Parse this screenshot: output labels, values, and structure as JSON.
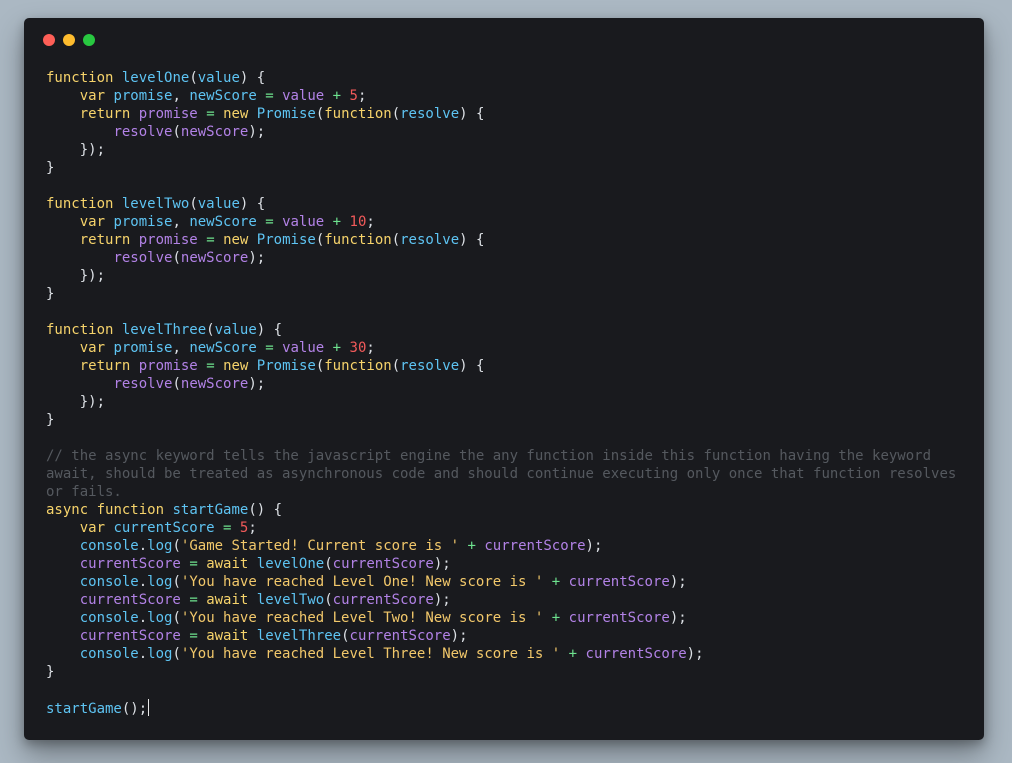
{
  "window": {
    "controls": [
      {
        "name": "close",
        "color": "#fe5f57"
      },
      {
        "name": "minimize",
        "color": "#febc2e"
      },
      {
        "name": "maximize",
        "color": "#28c840"
      }
    ]
  },
  "editor": {
    "lines": [
      [
        [
          "kw",
          "function"
        ],
        [
          "t",
          " "
        ],
        [
          "fn",
          "levelOne"
        ],
        [
          "punct",
          "("
        ],
        [
          "param",
          "value"
        ],
        [
          "punct",
          ") {"
        ]
      ],
      [
        [
          "t",
          "    "
        ],
        [
          "kw",
          "var"
        ],
        [
          "t",
          " "
        ],
        [
          "fn",
          "promise"
        ],
        [
          "punct",
          ", "
        ],
        [
          "fn",
          "newScore"
        ],
        [
          "t",
          " "
        ],
        [
          "op",
          "="
        ],
        [
          "t",
          " "
        ],
        [
          "var",
          "value"
        ],
        [
          "t",
          " "
        ],
        [
          "op",
          "+"
        ],
        [
          "t",
          " "
        ],
        [
          "num",
          "5"
        ],
        [
          "punct",
          ";"
        ]
      ],
      [
        [
          "t",
          "    "
        ],
        [
          "kw",
          "return"
        ],
        [
          "t",
          " "
        ],
        [
          "var",
          "promise"
        ],
        [
          "t",
          " "
        ],
        [
          "op",
          "="
        ],
        [
          "t",
          " "
        ],
        [
          "kw",
          "new"
        ],
        [
          "t",
          " "
        ],
        [
          "fn",
          "Promise"
        ],
        [
          "punct",
          "("
        ],
        [
          "kw",
          "function"
        ],
        [
          "punct",
          "("
        ],
        [
          "param",
          "resolve"
        ],
        [
          "punct",
          ") {"
        ]
      ],
      [
        [
          "t",
          "        "
        ],
        [
          "var",
          "resolve"
        ],
        [
          "punct",
          "("
        ],
        [
          "var",
          "newScore"
        ],
        [
          "punct",
          ");"
        ]
      ],
      [
        [
          "t",
          "    "
        ],
        [
          "punct",
          "});"
        ]
      ],
      [
        [
          "punct",
          "}"
        ]
      ],
      [],
      [
        [
          "kw",
          "function"
        ],
        [
          "t",
          " "
        ],
        [
          "fn",
          "levelTwo"
        ],
        [
          "punct",
          "("
        ],
        [
          "param",
          "value"
        ],
        [
          "punct",
          ") {"
        ]
      ],
      [
        [
          "t",
          "    "
        ],
        [
          "kw",
          "var"
        ],
        [
          "t",
          " "
        ],
        [
          "fn",
          "promise"
        ],
        [
          "punct",
          ", "
        ],
        [
          "fn",
          "newScore"
        ],
        [
          "t",
          " "
        ],
        [
          "op",
          "="
        ],
        [
          "t",
          " "
        ],
        [
          "var",
          "value"
        ],
        [
          "t",
          " "
        ],
        [
          "op",
          "+"
        ],
        [
          "t",
          " "
        ],
        [
          "num",
          "10"
        ],
        [
          "punct",
          ";"
        ]
      ],
      [
        [
          "t",
          "    "
        ],
        [
          "kw",
          "return"
        ],
        [
          "t",
          " "
        ],
        [
          "var",
          "promise"
        ],
        [
          "t",
          " "
        ],
        [
          "op",
          "="
        ],
        [
          "t",
          " "
        ],
        [
          "kw",
          "new"
        ],
        [
          "t",
          " "
        ],
        [
          "fn",
          "Promise"
        ],
        [
          "punct",
          "("
        ],
        [
          "kw",
          "function"
        ],
        [
          "punct",
          "("
        ],
        [
          "param",
          "resolve"
        ],
        [
          "punct",
          ") {"
        ]
      ],
      [
        [
          "t",
          "        "
        ],
        [
          "var",
          "resolve"
        ],
        [
          "punct",
          "("
        ],
        [
          "var",
          "newScore"
        ],
        [
          "punct",
          ");"
        ]
      ],
      [
        [
          "t",
          "    "
        ],
        [
          "punct",
          "});"
        ]
      ],
      [
        [
          "punct",
          "}"
        ]
      ],
      [],
      [
        [
          "kw",
          "function"
        ],
        [
          "t",
          " "
        ],
        [
          "fn",
          "levelThree"
        ],
        [
          "punct",
          "("
        ],
        [
          "param",
          "value"
        ],
        [
          "punct",
          ") {"
        ]
      ],
      [
        [
          "t",
          "    "
        ],
        [
          "kw",
          "var"
        ],
        [
          "t",
          " "
        ],
        [
          "fn",
          "promise"
        ],
        [
          "punct",
          ", "
        ],
        [
          "fn",
          "newScore"
        ],
        [
          "t",
          " "
        ],
        [
          "op",
          "="
        ],
        [
          "t",
          " "
        ],
        [
          "var",
          "value"
        ],
        [
          "t",
          " "
        ],
        [
          "op",
          "+"
        ],
        [
          "t",
          " "
        ],
        [
          "num",
          "30"
        ],
        [
          "punct",
          ";"
        ]
      ],
      [
        [
          "t",
          "    "
        ],
        [
          "kw",
          "return"
        ],
        [
          "t",
          " "
        ],
        [
          "var",
          "promise"
        ],
        [
          "t",
          " "
        ],
        [
          "op",
          "="
        ],
        [
          "t",
          " "
        ],
        [
          "kw",
          "new"
        ],
        [
          "t",
          " "
        ],
        [
          "fn",
          "Promise"
        ],
        [
          "punct",
          "("
        ],
        [
          "kw",
          "function"
        ],
        [
          "punct",
          "("
        ],
        [
          "param",
          "resolve"
        ],
        [
          "punct",
          ") {"
        ]
      ],
      [
        [
          "t",
          "        "
        ],
        [
          "var",
          "resolve"
        ],
        [
          "punct",
          "("
        ],
        [
          "var",
          "newScore"
        ],
        [
          "punct",
          ");"
        ]
      ],
      [
        [
          "t",
          "    "
        ],
        [
          "punct",
          "});"
        ]
      ],
      [
        [
          "punct",
          "}"
        ]
      ],
      [],
      [
        [
          "comment",
          "// the async keyword tells the javascript engine the any function inside this function having the keyword await, should be treated as asynchronous code and should continue executing only once that function resolves or fails."
        ]
      ],
      [
        [
          "kw",
          "async"
        ],
        [
          "t",
          " "
        ],
        [
          "kw",
          "function"
        ],
        [
          "t",
          " "
        ],
        [
          "fn",
          "startGame"
        ],
        [
          "punct",
          "() {"
        ]
      ],
      [
        [
          "t",
          "    "
        ],
        [
          "kw",
          "var"
        ],
        [
          "t",
          " "
        ],
        [
          "fn",
          "currentScore"
        ],
        [
          "t",
          " "
        ],
        [
          "op",
          "="
        ],
        [
          "t",
          " "
        ],
        [
          "num",
          "5"
        ],
        [
          "punct",
          ";"
        ]
      ],
      [
        [
          "t",
          "    "
        ],
        [
          "obj",
          "console"
        ],
        [
          "punct",
          "."
        ],
        [
          "fn",
          "log"
        ],
        [
          "punct",
          "("
        ],
        [
          "str",
          "'Game Started! Current score is '"
        ],
        [
          "t",
          " "
        ],
        [
          "op",
          "+"
        ],
        [
          "t",
          " "
        ],
        [
          "var",
          "currentScore"
        ],
        [
          "punct",
          ");"
        ]
      ],
      [
        [
          "t",
          "    "
        ],
        [
          "var",
          "currentScore"
        ],
        [
          "t",
          " "
        ],
        [
          "op",
          "="
        ],
        [
          "t",
          " "
        ],
        [
          "kw",
          "await"
        ],
        [
          "t",
          " "
        ],
        [
          "fn",
          "levelOne"
        ],
        [
          "punct",
          "("
        ],
        [
          "var",
          "currentScore"
        ],
        [
          "punct",
          ");"
        ]
      ],
      [
        [
          "t",
          "    "
        ],
        [
          "obj",
          "console"
        ],
        [
          "punct",
          "."
        ],
        [
          "fn",
          "log"
        ],
        [
          "punct",
          "("
        ],
        [
          "str",
          "'You have reached Level One! New score is '"
        ],
        [
          "t",
          " "
        ],
        [
          "op",
          "+"
        ],
        [
          "t",
          " "
        ],
        [
          "var",
          "currentScore"
        ],
        [
          "punct",
          ");"
        ]
      ],
      [
        [
          "t",
          "    "
        ],
        [
          "var",
          "currentScore"
        ],
        [
          "t",
          " "
        ],
        [
          "op",
          "="
        ],
        [
          "t",
          " "
        ],
        [
          "kw",
          "await"
        ],
        [
          "t",
          " "
        ],
        [
          "fn",
          "levelTwo"
        ],
        [
          "punct",
          "("
        ],
        [
          "var",
          "currentScore"
        ],
        [
          "punct",
          ");"
        ]
      ],
      [
        [
          "t",
          "    "
        ],
        [
          "obj",
          "console"
        ],
        [
          "punct",
          "."
        ],
        [
          "fn",
          "log"
        ],
        [
          "punct",
          "("
        ],
        [
          "str",
          "'You have reached Level Two! New score is '"
        ],
        [
          "t",
          " "
        ],
        [
          "op",
          "+"
        ],
        [
          "t",
          " "
        ],
        [
          "var",
          "currentScore"
        ],
        [
          "punct",
          ");"
        ]
      ],
      [
        [
          "t",
          "    "
        ],
        [
          "var",
          "currentScore"
        ],
        [
          "t",
          " "
        ],
        [
          "op",
          "="
        ],
        [
          "t",
          " "
        ],
        [
          "kw",
          "await"
        ],
        [
          "t",
          " "
        ],
        [
          "fn",
          "levelThree"
        ],
        [
          "punct",
          "("
        ],
        [
          "var",
          "currentScore"
        ],
        [
          "punct",
          ");"
        ]
      ],
      [
        [
          "t",
          "    "
        ],
        [
          "obj",
          "console"
        ],
        [
          "punct",
          "."
        ],
        [
          "fn",
          "log"
        ],
        [
          "punct",
          "("
        ],
        [
          "str",
          "'You have reached Level Three! New score is '"
        ],
        [
          "t",
          " "
        ],
        [
          "op",
          "+"
        ],
        [
          "t",
          " "
        ],
        [
          "var",
          "currentScore"
        ],
        [
          "punct",
          ");"
        ]
      ],
      [
        [
          "punct",
          "}"
        ]
      ],
      [],
      [
        [
          "fn",
          "startGame"
        ],
        [
          "punct",
          "();"
        ]
      ]
    ]
  }
}
